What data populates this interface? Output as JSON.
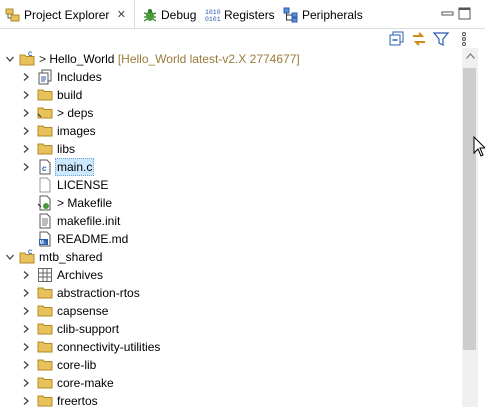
{
  "tabs": [
    {
      "label": "Project Explorer",
      "icon": "project-explorer-icon",
      "active": true,
      "close": "✕"
    },
    {
      "label": "Debug",
      "icon": "debug-icon",
      "active": false
    },
    {
      "label": "Registers",
      "icon": "registers-icon",
      "active": false
    },
    {
      "label": "Peripherals",
      "icon": "peripherals-icon",
      "active": false
    }
  ],
  "toolbar": {
    "buttons": [
      "collapse-all-icon",
      "link-with-editor-icon",
      "filter-icon",
      "view-menu-icon"
    ]
  },
  "window_buttons": [
    "minimize-icon",
    "maximize-icon"
  ],
  "tree": {
    "rows": [
      {
        "label": "Hello_World",
        "decoration": "[Hello_World latest-v2.X 2774677]",
        "prefix": "> ",
        "icon": "c-project-icon",
        "expanded": true
      },
      {
        "label": "Includes",
        "icon": "includes-icon",
        "expanded": false
      },
      {
        "label": "build",
        "icon": "folder-icon",
        "expanded": false
      },
      {
        "label": "deps",
        "prefix": "> ",
        "icon": "folder-modified-icon",
        "expanded": false
      },
      {
        "label": "images",
        "icon": "folder-icon",
        "expanded": false
      },
      {
        "label": "libs",
        "icon": "folder-icon",
        "expanded": false
      },
      {
        "label": "main.c",
        "icon": "c-source-file-icon",
        "expanded": false,
        "selected": true
      },
      {
        "label": "LICENSE",
        "icon": "blank-file-icon"
      },
      {
        "label": "Makefile",
        "prefix": "> ",
        "icon": "makefile-icon"
      },
      {
        "label": "makefile.init",
        "icon": "text-file-icon"
      },
      {
        "label": "README.md",
        "icon": "markdown-file-icon"
      },
      {
        "label": "mtb_shared",
        "icon": "c-project-icon",
        "expanded": true
      },
      {
        "label": "Archives",
        "icon": "archives-icon",
        "expanded": false
      },
      {
        "label": "abstraction-rtos",
        "icon": "folder-icon",
        "expanded": false
      },
      {
        "label": "capsense",
        "icon": "folder-icon",
        "expanded": false
      },
      {
        "label": "clib-support",
        "icon": "folder-icon",
        "expanded": false
      },
      {
        "label": "connectivity-utilities",
        "icon": "folder-icon",
        "expanded": false
      },
      {
        "label": "core-lib",
        "icon": "folder-icon",
        "expanded": false
      },
      {
        "label": "core-make",
        "icon": "folder-icon",
        "expanded": false
      },
      {
        "label": "freertos",
        "icon": "folder-icon",
        "expanded": false
      }
    ]
  },
  "colors": {
    "selection": "#cce8ff",
    "decoration": "#9a7a3a",
    "folder": "#e8c15a",
    "scroll_thumb": "#cdcdcd"
  }
}
